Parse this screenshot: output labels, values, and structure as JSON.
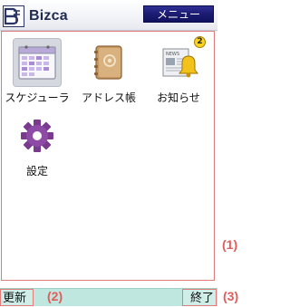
{
  "header": {
    "brand": "Bizca",
    "logo_icon": "bizca-logo-icon",
    "menu_label": "メニュー"
  },
  "apps": [
    {
      "label": "スケジューラ",
      "icon": "calendar-icon",
      "selected": true
    },
    {
      "label": "アドレス帳",
      "icon": "address-book-icon",
      "selected": false
    },
    {
      "label": "お知らせ",
      "icon": "news-bell-icon",
      "badge": "2",
      "selected": false
    },
    {
      "label": "設定",
      "icon": "gear-icon",
      "selected": false
    }
  ],
  "news_icon_text": "NEWS",
  "footer": {
    "left_key": "更新",
    "right_key": "終了"
  },
  "annotations": {
    "content": "(1)",
    "left_key": "(2)",
    "right_key": "(3)"
  },
  "colors": {
    "accent": "#1c1c73",
    "annotation": "#e45a5a",
    "footer_bg": "#bfe6df",
    "selected_tile": "#d6d8df"
  }
}
